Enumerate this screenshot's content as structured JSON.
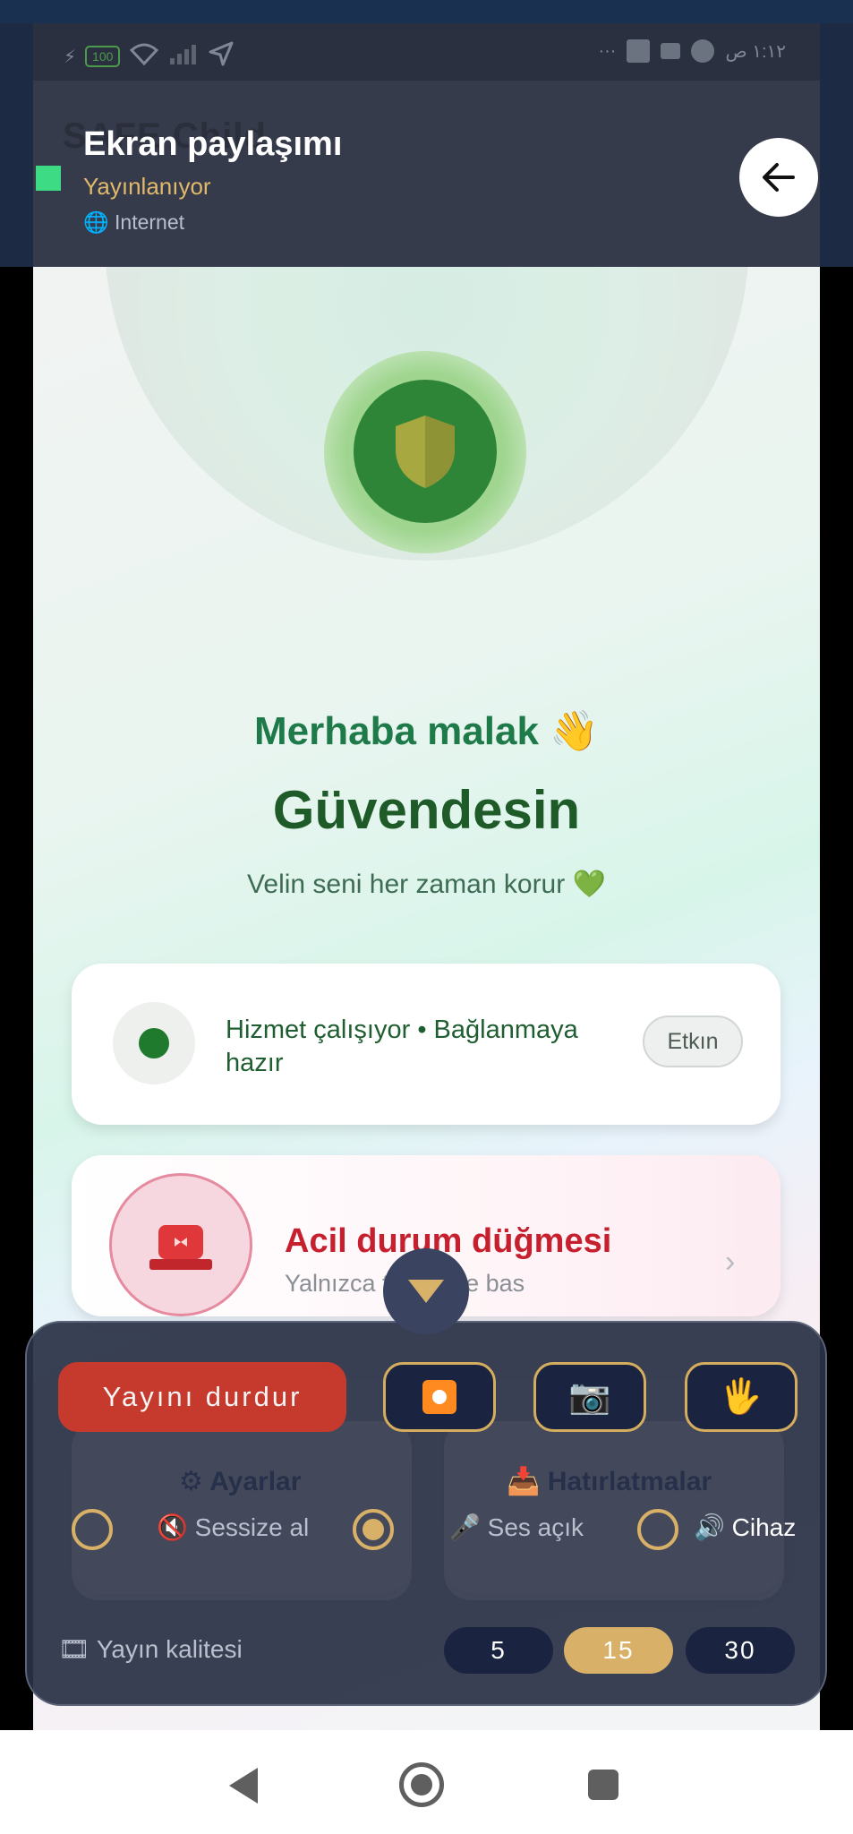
{
  "status_bar": {
    "battery": "100",
    "time": "١:١٢ ص"
  },
  "share_overlay": {
    "app_title_ghost": "SAFE Child",
    "title": "Ekran paylaşımı",
    "status": "Yayınlanıyor",
    "network": "🌐 Internet",
    "back_icon": "arrow-left-icon"
  },
  "hero": {
    "greeting": "Merhaba malak",
    "wave": "👋",
    "title": "Güvendesin",
    "subtitle": "Velin seni her zaman korur",
    "heart": "💚"
  },
  "service_card": {
    "text": "Hizmet çalışıyor • Bağlanmaya hazır",
    "badge": "Etkın"
  },
  "emergency_card": {
    "title": "Acil durum düğmesi",
    "subtitle": "Yalnızca tehlikede bas",
    "chevron": "›"
  },
  "ghost_cards": {
    "settings": "⚙ Ayarlar",
    "reminders": "📥 Hatırlatmalar"
  },
  "controls": {
    "stop_label": "Yayını durdur",
    "camera_icon": "📷",
    "hand_icon": "🖐",
    "audio_options": [
      {
        "label": "🔇 Sessize al",
        "selected": false
      },
      {
        "label": "🎤 Ses açık",
        "selected": true
      },
      {
        "label": "🔊 Cihaz",
        "selected": false
      }
    ],
    "quality_label": "🎞 Yayın kalitesi",
    "quality_options": [
      "5",
      "15",
      "30"
    ],
    "quality_selected": "15",
    "accent_color": "#d8b067",
    "stop_color": "#c53a2d"
  }
}
